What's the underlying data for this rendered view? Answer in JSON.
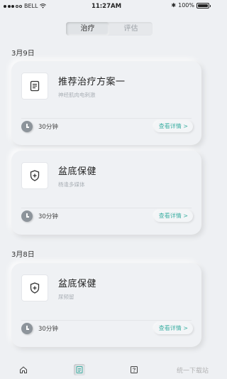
{
  "status_bar": {
    "carrier": "BELL",
    "time": "11:27AM",
    "bluetooth": "✱",
    "battery": "100%"
  },
  "tabs": [
    {
      "label": "治疗",
      "active": true
    },
    {
      "label": "评估",
      "active": false
    }
  ],
  "sections": [
    {
      "date": "3月9日"
    },
    {
      "date": "3月8日"
    }
  ],
  "cards": [
    {
      "title": "推荐治疗方案一",
      "subtitle": "神经肌肉电刺激",
      "icon": "document-icon",
      "duration": "30分钟",
      "detail_label": "查看详情 >"
    },
    {
      "title": "盆底保健",
      "subtitle": "杨逢多媒体",
      "icon": "shield-plus-icon",
      "duration": "30分钟",
      "detail_label": "查看详情 >"
    },
    {
      "title": "盆底保健",
      "subtitle": "尿频留",
      "icon": "shield-plus-icon",
      "duration": "30分钟",
      "detail_label": "查看详情 >"
    }
  ],
  "bottom_nav": [
    {
      "icon": "home-icon",
      "active": false
    },
    {
      "icon": "list-icon",
      "active": true
    },
    {
      "icon": "help-icon",
      "active": false
    }
  ],
  "watermark": "统一下载站"
}
